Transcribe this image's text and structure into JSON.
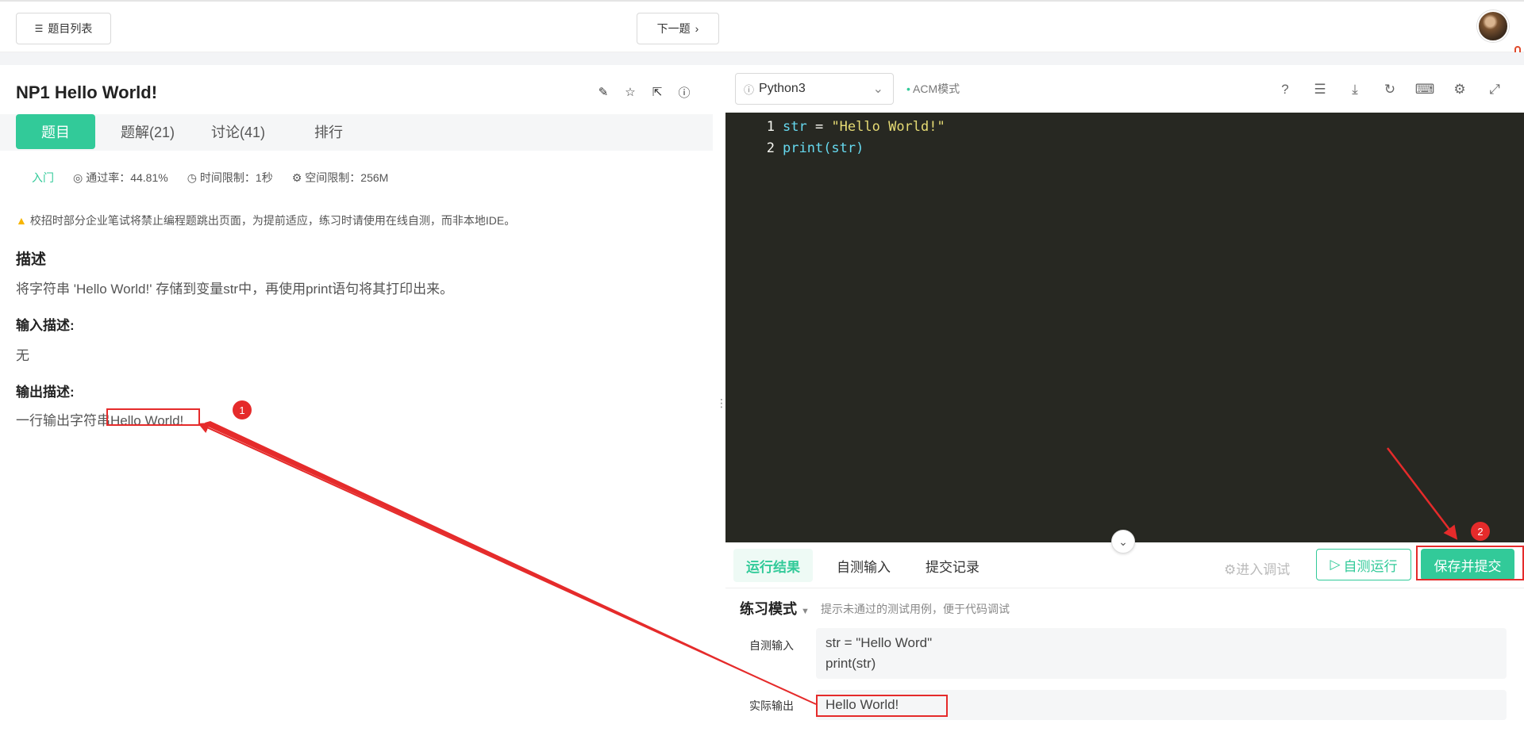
{
  "topbar": {
    "problem_list_label": "题目列表",
    "next_label": "下一题"
  },
  "problem": {
    "title": "NP1  Hello World!",
    "tabs": [
      {
        "label": "题目"
      },
      {
        "label": "题解(21)"
      },
      {
        "label": "讨论(41)"
      },
      {
        "label": "排行"
      }
    ],
    "level": "入门",
    "pass_rate": "通过率：44.81%",
    "time_limit": "时间限制：1秒",
    "space_limit": "空间限制：256M",
    "warning": "校招时部分企业笔试将禁止编程题跳出页面，为提前适应，练习时请使用在线自测，而非本地IDE。",
    "desc_title": "描述",
    "desc_text": "将字符串 'Hello World!' 存储到变量str中，再使用print语句将其打印出来。",
    "input_title": "输入描述:",
    "input_text": "无",
    "output_title": "输出描述:",
    "output_text_prefix": "一行输出字符串",
    "output_text_value": "Hello World!"
  },
  "editor": {
    "language": "Python3",
    "mode": "ACM模式",
    "lines": [
      {
        "num": "1",
        "var": "str",
        "op": " = ",
        "val": "\"Hello World!\""
      },
      {
        "num": "2",
        "fn": "print",
        "arg": "(str)"
      }
    ]
  },
  "results": {
    "tabs": [
      {
        "label": "运行结果"
      },
      {
        "label": "自测输入"
      },
      {
        "label": "提交记录"
      }
    ],
    "debug_label": "进入调试",
    "selfrun_label": "自测运行",
    "submit_label": "保存并提交",
    "practice_mode": "练习模式",
    "practice_hint": "提示未通过的测试用例，便于代码调试",
    "self_input_label": "自测输入",
    "self_input_lines": [
      "str = \"Hello Word\"",
      "print(str)"
    ],
    "actual_output_label": "实际输出",
    "actual_output": "Hello World!"
  },
  "annotations": {
    "badge1": "1",
    "badge2": "2"
  },
  "colors": {
    "accent": "#32ca99",
    "editor_bg": "#272822",
    "annotation": "#e52b2b"
  }
}
